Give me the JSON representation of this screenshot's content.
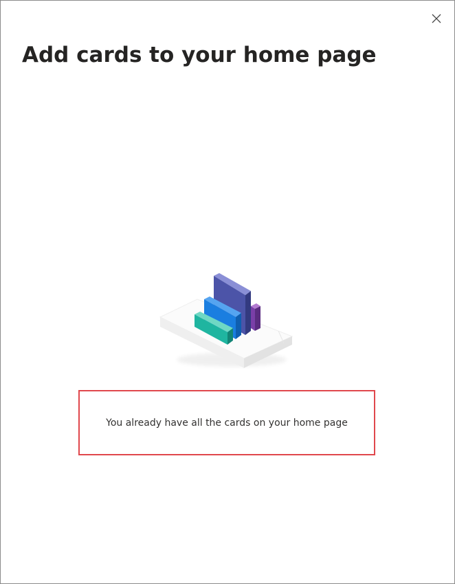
{
  "dialog": {
    "title": "Add cards to your home page",
    "close_icon": "close-icon",
    "illustration_icon": "cards-illustration",
    "empty_message": "You already have all the cards on your home page",
    "highlight_color": "#e0474c"
  }
}
